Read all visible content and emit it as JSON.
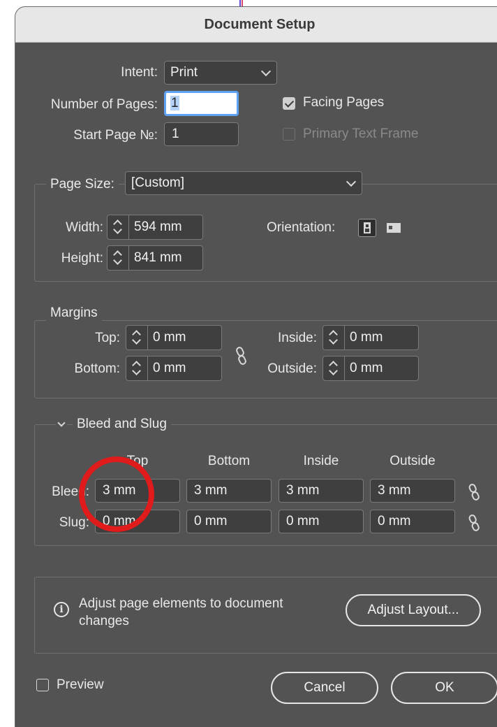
{
  "dialog": {
    "title": "Document Setup"
  },
  "document": {
    "intent_label": "Intent:",
    "intent_value": "Print",
    "pages_label": "Number of Pages:",
    "pages_value": "1",
    "start_label": "Start Page №:",
    "start_value": "1",
    "facing_label": "Facing Pages",
    "facing_checked": true,
    "primary_label": "Primary Text Frame",
    "primary_checked": false
  },
  "page_size": {
    "label": "Page Size:",
    "value": "[Custom]",
    "width_label": "Width:",
    "width_value": "594 mm",
    "height_label": "Height:",
    "height_value": "841 mm",
    "orientation_label": "Orientation:",
    "orientation_selected": "portrait"
  },
  "margins": {
    "title": "Margins",
    "top_label": "Top:",
    "top_value": "0 mm",
    "bottom_label": "Bottom:",
    "bottom_value": "0 mm",
    "inside_label": "Inside:",
    "inside_value": "0 mm",
    "outside_label": "Outside:",
    "outside_value": "0 mm"
  },
  "bleed_slug": {
    "title": "Bleed and Slug",
    "columns": [
      "Top",
      "Bottom",
      "Inside",
      "Outside"
    ],
    "bleed_label": "Bleed:",
    "bleed_values": [
      "3 mm",
      "3 mm",
      "3 mm",
      "3 mm"
    ],
    "slug_label": "Slug:",
    "slug_values": [
      "0 mm",
      "0 mm",
      "0 mm",
      "0 mm"
    ]
  },
  "adjust": {
    "info_icon": "i",
    "text_line1": "Adjust page elements to document",
    "text_line2": "changes",
    "button_label": "Adjust Layout..."
  },
  "footer": {
    "preview_label": "Preview",
    "preview_checked": false,
    "cancel_label": "Cancel",
    "ok_label": "OK"
  },
  "colors": {
    "dialog_bg": "#535353",
    "field_bg": "#3f3f3f",
    "focus_ring": "#5fa0f0",
    "annotation_circle": "#e01b1b"
  }
}
